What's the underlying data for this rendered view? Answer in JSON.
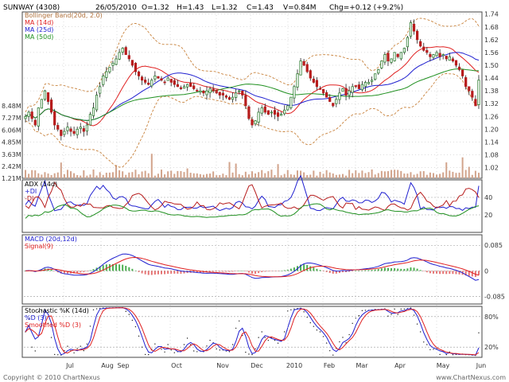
{
  "header": {
    "symbol": "SUNWAY (4308)",
    "date": "26/05/2010",
    "open": "O=1.32",
    "high": "H=1.43",
    "low": "L=1.32",
    "close": "C=1.43",
    "volume": "V=0.84M",
    "change": "Chg=+0.12 (+9.2%)"
  },
  "footer": {
    "copyright": "Copyright © 2010 ChartNexus",
    "brand": "www.ChartNexus.com"
  },
  "colors": {
    "up": "#2e7d32",
    "down": "#b71c1c",
    "bollinger": "#c8823c",
    "ma14": "#e02020",
    "ma25": "#2020d0",
    "ma50": "#209020",
    "volume": "#d2a48c",
    "grid": "#bbbbbb"
  },
  "chart_data": [
    {
      "type": "candlestick",
      "x_ticks": [
        "Jul",
        "Aug",
        "Sep",
        "Oct",
        "Nov",
        "Dec",
        "2010",
        "Feb",
        "Mar",
        "Apr",
        "May",
        "Jun"
      ],
      "y_ticks": [
        "1.74",
        "1.68",
        "1.62",
        "1.56",
        "1.50",
        "1.44",
        "1.38",
        "1.32",
        "1.26",
        "1.20",
        "1.14",
        "1.08",
        "1.02"
      ],
      "ylim": [
        0.97,
        1.75
      ],
      "legend": [
        "Bollinger Band(20d, 2.0)",
        "MA (14d)",
        "MA (25d)",
        "MA (50d)"
      ],
      "close": [
        1.26,
        1.28,
        1.25,
        1.22,
        1.3,
        1.34,
        1.38,
        1.33,
        1.28,
        1.22,
        1.2,
        1.17,
        1.19,
        1.21,
        1.19,
        1.18,
        1.2,
        1.21,
        1.19,
        1.22,
        1.27,
        1.3,
        1.36,
        1.4,
        1.45,
        1.47,
        1.49,
        1.51,
        1.53,
        1.56,
        1.58,
        1.55,
        1.53,
        1.5,
        1.47,
        1.45,
        1.43,
        1.42,
        1.41,
        1.43,
        1.45,
        1.44,
        1.43,
        1.42,
        1.44,
        1.42,
        1.41,
        1.4,
        1.39,
        1.4,
        1.41,
        1.4,
        1.39,
        1.38,
        1.38,
        1.37,
        1.38,
        1.39,
        1.38,
        1.37,
        1.36,
        1.36,
        1.35,
        1.34,
        1.35,
        1.37,
        1.38,
        1.36,
        1.31,
        1.25,
        1.22,
        1.24,
        1.28,
        1.3,
        1.28,
        1.27,
        1.28,
        1.27,
        1.26,
        1.27,
        1.29,
        1.31,
        1.35,
        1.4,
        1.46,
        1.52,
        1.5,
        1.47,
        1.44,
        1.42,
        1.4,
        1.39,
        1.37,
        1.35,
        1.33,
        1.31,
        1.34,
        1.37,
        1.39,
        1.36,
        1.38,
        1.4,
        1.4,
        1.39,
        1.41,
        1.42,
        1.42,
        1.43,
        1.46,
        1.48,
        1.52,
        1.55,
        1.52,
        1.53,
        1.56,
        1.54,
        1.56,
        1.58,
        1.63,
        1.7,
        1.66,
        1.62,
        1.59,
        1.57,
        1.56,
        1.54,
        1.55,
        1.56,
        1.54,
        1.55,
        1.53,
        1.54,
        1.52,
        1.5,
        1.48,
        1.45,
        1.4,
        1.38,
        1.35,
        1.31,
        1.43
      ],
      "volume_ticks": [
        "8.48M",
        "7.27M",
        "6.06M",
        "4.85M",
        "3.63M",
        "2.42M",
        "1.21M"
      ]
    },
    {
      "type": "line",
      "title": "ADX (14d)",
      "series": [
        {
          "name": "ADX (14d)"
        },
        {
          "name": "+DI"
        },
        {
          "name": "-DI"
        }
      ],
      "y_ticks": [
        "40",
        "20"
      ],
      "ylim": [
        0,
        60
      ]
    },
    {
      "type": "line",
      "title": "MACD (20d,12d)",
      "series": [
        {
          "name": "MACD (20d,12d)"
        },
        {
          "name": "Signal(9)"
        }
      ],
      "y_ticks": [
        "0.085",
        "0",
        "-0.085"
      ],
      "ylim": [
        -0.11,
        0.12
      ]
    },
    {
      "type": "line",
      "title": "Stochastic %K (14d)",
      "series": [
        {
          "name": "Stochastic %K (14d)"
        },
        {
          "name": "%D (3)"
        },
        {
          "name": "Smoothed %D (3)"
        }
      ],
      "y_ticks": [
        "80%",
        "20%"
      ],
      "ylim": [
        0,
        100
      ]
    }
  ]
}
